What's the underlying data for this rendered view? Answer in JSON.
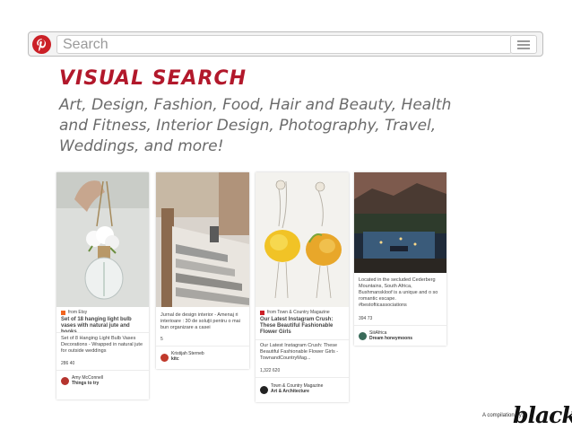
{
  "search": {
    "placeholder": "Search"
  },
  "heading": {
    "title": "VISUAL SEARCH",
    "subtitle": "Art, Design, Fashion, Food, Hair and Beauty, Health and Fitness, Interior Design, Photography, Travel, Weddings, and more!"
  },
  "pins": [
    {
      "source": "from Etsy",
      "title": "Set of 18 hanging light bulb vases with natural jute and hooks",
      "description": "Set of 8 Hanging Light Bulb Vases Decorations - Wrapped in natural jute for outside weddings",
      "stats": "286  40",
      "user": "Amy McConnell",
      "board": "Things to try"
    },
    {
      "description": "Jurnal de design interior - Amenaj ri interioare : 30 de soluţii pentru o mai bun organizare a casei",
      "stats": "5",
      "user": "Kristijah Sterneb",
      "board": "kitc"
    },
    {
      "source": "from Town & Country Magazine",
      "title": "Our Latest Instagram Crush: These Beautiful Fashionable Flower Girls",
      "description": "Our Latest Instagram Crush: These Beautiful Fashionable Flower Girls - TownandCountryMag...",
      "stats": "1,322  620",
      "user": "Town & Country Magazine",
      "board": "Art & Architecture"
    },
    {
      "description": "Located in the secluded Cederberg Mountains, South Africa, Bushmanskloof is a unique and o so romantic escape. #bestofticassociations",
      "stats": "394  73",
      "user": "SiiiAfrica",
      "board": "Dream honeymoons"
    }
  ],
  "footer": {
    "label": "A compilation by:",
    "brand": "black"
  },
  "colors": {
    "accent": "#b2182b",
    "pinterest_red": "#cb2027"
  },
  "icons": {
    "logo": "pinterest-logo-icon",
    "menu": "hamburger-menu-icon"
  }
}
